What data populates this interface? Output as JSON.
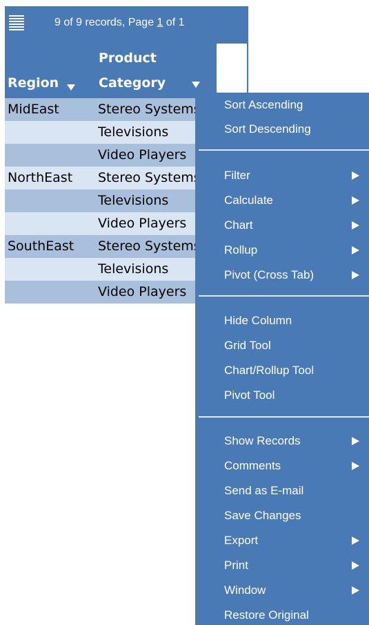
{
  "toolbar": {
    "status_prefix": "9 of 9 records, Page ",
    "page_current": "1",
    "status_suffix": " of 1"
  },
  "columns": {
    "region": "Region",
    "category_line1": "Product",
    "category_line2": "Category"
  },
  "rows": [
    {
      "region": "MidEast",
      "category": "Stereo Systems"
    },
    {
      "region": "",
      "category": "Televisions"
    },
    {
      "region": "",
      "category": "Video Players"
    },
    {
      "region": "NorthEast",
      "category": "Stereo Systems"
    },
    {
      "region": "",
      "category": "Televisions"
    },
    {
      "region": "",
      "category": "Video Players"
    },
    {
      "region": "SouthEast",
      "category": "Stereo Systems"
    },
    {
      "region": "",
      "category": "Televisions"
    },
    {
      "region": "",
      "category": "Video Players"
    }
  ],
  "menu": {
    "sort_ascending": "Sort Ascending",
    "sort_descending": "Sort Descending",
    "filter": "Filter",
    "calculate": "Calculate",
    "chart": "Chart",
    "rollup": "Rollup",
    "pivot": "Pivot (Cross Tab)",
    "hide_column": "Hide Column",
    "grid_tool": "Grid Tool",
    "chart_rollup_tool": "Chart/Rollup Tool",
    "pivot_tool": "Pivot Tool",
    "show_records": "Show Records",
    "comments": "Comments",
    "send_email": "Send as E-mail",
    "save_changes": "Save Changes",
    "export": "Export",
    "print": "Print",
    "window": "Window",
    "restore_original": "Restore Original"
  },
  "colors": {
    "header_blue": "#4a7ab5",
    "row_dark": "#a9c0dc",
    "row_light": "#dae5f3"
  }
}
